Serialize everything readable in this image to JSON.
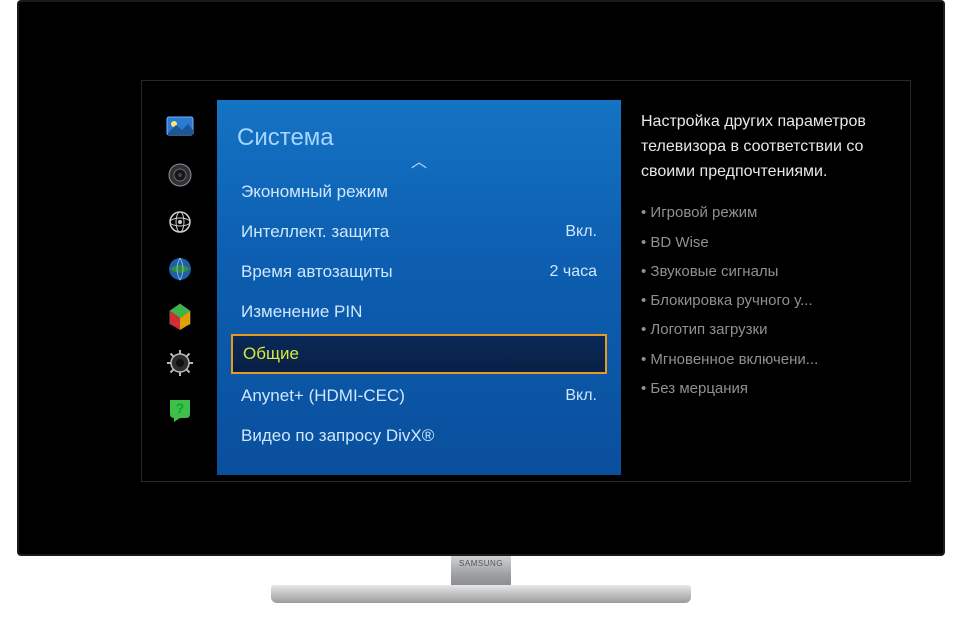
{
  "brand": "SAMSUNG",
  "sidebar": {
    "items": [
      {
        "name": "picture-icon"
      },
      {
        "name": "sound-icon"
      },
      {
        "name": "broadcast-icon"
      },
      {
        "name": "network-icon"
      },
      {
        "name": "smart-hub-icon"
      },
      {
        "name": "system-icon"
      },
      {
        "name": "support-icon"
      }
    ]
  },
  "menu": {
    "title": "Система",
    "items": [
      {
        "label": "Экономный режим",
        "value": ""
      },
      {
        "label": "Интеллект. защита",
        "value": "Вкл."
      },
      {
        "label": "Время автозащиты",
        "value": "2 часа"
      },
      {
        "label": "Изменение PIN",
        "value": ""
      },
      {
        "label": "Общие",
        "value": "",
        "selected": true
      },
      {
        "label": "Anynet+ (HDMI-CEC)",
        "value": "Вкл."
      },
      {
        "label": "Видео по запросу DivX®",
        "value": ""
      }
    ]
  },
  "help": {
    "description": "Настройка других параметров телевизора в соответствии со своими предпочтениями.",
    "bullets": [
      "Игровой режим",
      "BD Wise",
      "Звуковые сигналы",
      "Блокировка ручного у...",
      "Логотип загрузки",
      "Мгновенное включени...",
      "Без мерцания"
    ]
  }
}
